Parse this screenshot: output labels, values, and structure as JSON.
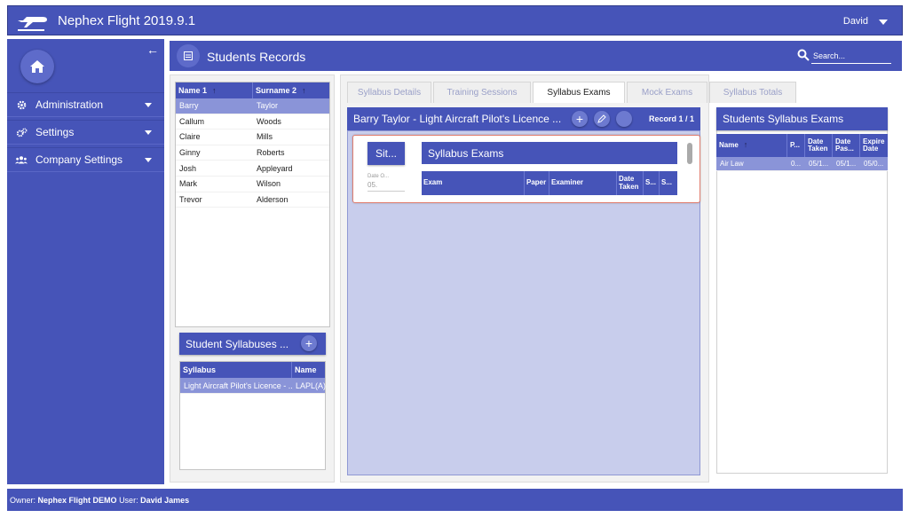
{
  "app": {
    "title": "Nephex Flight 2019.9.1",
    "user": "David"
  },
  "sidebar": {
    "items": [
      {
        "label": "Administration",
        "icon": "gear-icon"
      },
      {
        "label": "Settings",
        "icon": "gears-icon"
      },
      {
        "label": "Company Settings",
        "icon": "users-icon"
      }
    ]
  },
  "page": {
    "title": "Students Records",
    "search_placeholder": "Search..."
  },
  "students": {
    "columns": [
      "Name 1",
      "Surname 2"
    ],
    "rows": [
      [
        "Barry",
        "Taylor"
      ],
      [
        "Callum",
        "Woods"
      ],
      [
        "Claire",
        "Mills"
      ],
      [
        "Ginny",
        "Roberts"
      ],
      [
        "Josh",
        "Appleyard"
      ],
      [
        "Mark",
        "Wilson"
      ],
      [
        "Trevor",
        "Alderson"
      ]
    ],
    "selected": 0
  },
  "syllabuses": {
    "title": "Student Syllabuses ...",
    "add_label": "+",
    "columns": [
      "Syllabus",
      "Name"
    ],
    "rows": [
      [
        "Light Aircraft Pilot's Licence - ...",
        "LAPL(A)"
      ]
    ]
  },
  "tabs": [
    "Syllabus Details",
    "Training Sessions",
    "Syllabus Exams",
    "Mock Exams",
    "Syllabus Totals"
  ],
  "active_tab": 2,
  "record": {
    "title": "Barry Taylor - Light Aircraft Pilot's Licence ...",
    "counter": "Record 1 / 1",
    "add_label": "+",
    "sit_label": "Sit...",
    "date_label": "Date O...",
    "date_value": "05.",
    "exams_title": "Syllabus Exams",
    "exam_columns": [
      "Exam",
      "Paper",
      "Examiner",
      "Date Taken",
      "S...",
      "S..."
    ]
  },
  "right_panel": {
    "title": "Students Syllabus Exams",
    "columns": [
      "Name",
      "P...",
      "Date Taken",
      "Date Pas...",
      "Expire Date"
    ],
    "rows": [
      [
        "Air Law",
        "0...",
        "05/1...",
        "05/1...",
        "05/0..."
      ]
    ]
  },
  "footer": {
    "owner_label": "Owner:",
    "owner": "Nephex Flight DEMO",
    "user_label": "User:",
    "user": "David James"
  },
  "colors": {
    "brand": "#4654b8",
    "selected_row": "#8a94d8",
    "record_body": "#c8cdec",
    "card_border": "#e07d6f"
  }
}
